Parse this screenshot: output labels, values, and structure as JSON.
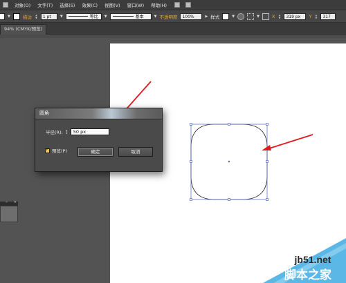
{
  "menubar": {
    "items": [
      "对象(O)",
      "文字(T)",
      "选择(S)",
      "效果(C)",
      "视图(V)",
      "窗口(W)",
      "帮助(H)"
    ]
  },
  "controlbar": {
    "stroke_label": "描边",
    "stroke_weight": "1 pt",
    "profile_label": "等比",
    "brush_label": "基本",
    "opacity_label": "不透明度",
    "opacity_value": "100%",
    "style_label": "样式",
    "x_value": "319 px",
    "y_value": "317"
  },
  "document_tab": {
    "label": "94% (CMYK/预览)"
  },
  "dialog": {
    "title": "圆角",
    "radius_label": "半径(R):",
    "radius_value": "50 px",
    "preview_label": "预览(P)",
    "preview_checked": true,
    "ok_label": "确定",
    "cancel_label": "取消"
  },
  "watermark": {
    "site": "jb51.net",
    "name": "脚本之家"
  },
  "colors": {
    "workspace": "#535353",
    "selection": "#4d63c5",
    "arrow": "#e0191c",
    "accent_label": "#e8a23a"
  }
}
